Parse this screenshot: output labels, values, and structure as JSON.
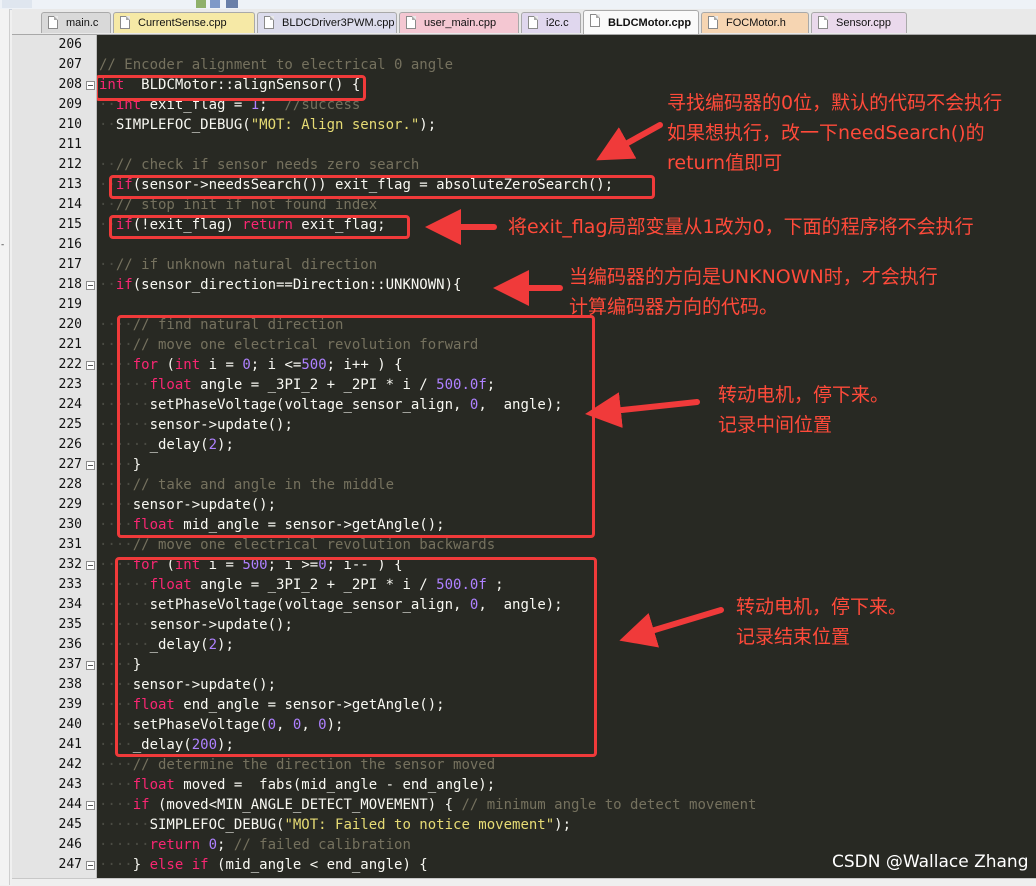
{
  "tabs": [
    {
      "label": "main.c",
      "color": "#d9d9d9",
      "active": false
    },
    {
      "label": "CurrentSense.cpp",
      "color": "#f6e9a6",
      "active": false
    },
    {
      "label": "BLDCDriver3PWM.cpp",
      "color": "#dcdcec",
      "active": false
    },
    {
      "label": "user_main.cpp",
      "color": "#f4c7d2",
      "active": false
    },
    {
      "label": "i2c.c",
      "color": "#e0d7ee",
      "active": false
    },
    {
      "label": "BLDCMotor.cpp",
      "color": "#fafafa",
      "active": true
    },
    {
      "label": "FOCMotor.h",
      "color": "#f6d5b2",
      "active": false
    },
    {
      "label": "Sensor.cpp",
      "color": "#ead9ec",
      "active": false
    }
  ],
  "line_numbers": [
    "206",
    "207",
    "208",
    "209",
    "210",
    "211",
    "212",
    "213",
    "214",
    "215",
    "216",
    "217",
    "218",
    "219",
    "220",
    "221",
    "222",
    "223",
    "224",
    "225",
    "226",
    "227",
    "228",
    "229",
    "230",
    "231",
    "232",
    "233",
    "234",
    "235",
    "236",
    "237",
    "238",
    "239",
    "240",
    "241",
    "242",
    "243",
    "244",
    "245",
    "246",
    "247"
  ],
  "fold_lines": [
    "208",
    "218",
    "222",
    "227",
    "232",
    "237",
    "244",
    "247"
  ],
  "code_lines": [
    [],
    [
      [
        "cm",
        "// Encoder alignment to electrical 0 angle"
      ]
    ],
    [
      [
        "ty",
        "int"
      ],
      [
        "",
        "  BLDCMotor::alignSensor() {"
      ]
    ],
    [
      [
        "ws",
        "  "
      ],
      [
        "ty",
        "int"
      ],
      [
        "",
        " exit_flag = "
      ],
      [
        "nm",
        "1"
      ],
      [
        "",
        ";  "
      ],
      [
        "cm",
        "//success"
      ]
    ],
    [
      [
        "ws",
        "  "
      ],
      [
        "",
        "SIMPLEFOC_DEBUG("
      ],
      [
        "st",
        "\"MOT: Align sensor.\""
      ],
      [
        "",
        ");"
      ]
    ],
    [],
    [
      [
        "ws",
        "  "
      ],
      [
        "cm",
        "// check if sensor needs zero search"
      ]
    ],
    [
      [
        "ws",
        "  "
      ],
      [
        "kw",
        "if"
      ],
      [
        "",
        "(sensor->needsSearch()) exit_flag = absoluteZeroSearch();"
      ]
    ],
    [
      [
        "ws",
        "  "
      ],
      [
        "cm",
        "// stop init if not found index"
      ]
    ],
    [
      [
        "ws",
        "  "
      ],
      [
        "kw",
        "if"
      ],
      [
        "",
        "(!exit_flag) "
      ],
      [
        "kw",
        "return"
      ],
      [
        "",
        " exit_flag;"
      ]
    ],
    [],
    [
      [
        "ws",
        "  "
      ],
      [
        "cm",
        "// if unknown natural direction"
      ]
    ],
    [
      [
        "ws",
        "  "
      ],
      [
        "kw",
        "if"
      ],
      [
        "",
        "(sensor_direction==Direction::UNKNOWN){"
      ]
    ],
    [],
    [
      [
        "ws",
        "    "
      ],
      [
        "cm",
        "// find natural direction"
      ]
    ],
    [
      [
        "ws",
        "    "
      ],
      [
        "cm",
        "// move one electrical revolution forward"
      ]
    ],
    [
      [
        "ws",
        "    "
      ],
      [
        "kw",
        "for"
      ],
      [
        "",
        " ("
      ],
      [
        "ty",
        "int"
      ],
      [
        "",
        " i = "
      ],
      [
        "nm",
        "0"
      ],
      [
        "",
        "; i <="
      ],
      [
        "nm",
        "500"
      ],
      [
        "",
        "; i++ ) {"
      ]
    ],
    [
      [
        "ws",
        "      "
      ],
      [
        "ty",
        "float"
      ],
      [
        "",
        " angle = _3PI_2 + _2PI * i / "
      ],
      [
        "nm",
        "500.0f"
      ],
      [
        "",
        ";"
      ]
    ],
    [
      [
        "ws",
        "      "
      ],
      [
        "",
        "setPhaseVoltage(voltage_sensor_align, "
      ],
      [
        "nm",
        "0"
      ],
      [
        "",
        ",  angle);"
      ]
    ],
    [
      [
        "ws",
        "      "
      ],
      [
        "",
        "sensor->update();"
      ]
    ],
    [
      [
        "ws",
        "      "
      ],
      [
        "",
        "_delay("
      ],
      [
        "nm",
        "2"
      ],
      [
        "",
        ");"
      ]
    ],
    [
      [
        "ws",
        "    "
      ],
      [
        "",
        "}"
      ]
    ],
    [
      [
        "ws",
        "    "
      ],
      [
        "cm",
        "// take and angle in the middle"
      ]
    ],
    [
      [
        "ws",
        "    "
      ],
      [
        "",
        "sensor->update();"
      ]
    ],
    [
      [
        "ws",
        "    "
      ],
      [
        "ty",
        "float"
      ],
      [
        "",
        " mid_angle = sensor->getAngle();"
      ]
    ],
    [
      [
        "ws",
        "    "
      ],
      [
        "cm",
        "// move one electrical revolution backwards"
      ]
    ],
    [
      [
        "ws",
        "    "
      ],
      [
        "kw",
        "for"
      ],
      [
        "",
        " ("
      ],
      [
        "ty",
        "int"
      ],
      [
        "",
        " i = "
      ],
      [
        "nm",
        "500"
      ],
      [
        "",
        "; i >="
      ],
      [
        "nm",
        "0"
      ],
      [
        "",
        "; i-- ) {"
      ]
    ],
    [
      [
        "ws",
        "      "
      ],
      [
        "ty",
        "float"
      ],
      [
        "",
        " angle = _3PI_2 + _2PI * i / "
      ],
      [
        "nm",
        "500.0f"
      ],
      [
        "",
        " ;"
      ]
    ],
    [
      [
        "ws",
        "      "
      ],
      [
        "",
        "setPhaseVoltage(voltage_sensor_align, "
      ],
      [
        "nm",
        "0"
      ],
      [
        "",
        ",  angle);"
      ]
    ],
    [
      [
        "ws",
        "      "
      ],
      [
        "",
        "sensor->update();"
      ]
    ],
    [
      [
        "ws",
        "      "
      ],
      [
        "",
        "_delay("
      ],
      [
        "nm",
        "2"
      ],
      [
        "",
        ");"
      ]
    ],
    [
      [
        "ws",
        "    "
      ],
      [
        "",
        "}"
      ]
    ],
    [
      [
        "ws",
        "    "
      ],
      [
        "",
        "sensor->update();"
      ]
    ],
    [
      [
        "ws",
        "    "
      ],
      [
        "ty",
        "float"
      ],
      [
        "",
        " end_angle = sensor->getAngle();"
      ]
    ],
    [
      [
        "ws",
        "    "
      ],
      [
        "",
        "setPhaseVoltage("
      ],
      [
        "nm",
        "0"
      ],
      [
        "",
        ", "
      ],
      [
        "nm",
        "0"
      ],
      [
        "",
        ", "
      ],
      [
        "nm",
        "0"
      ],
      [
        "",
        ");"
      ]
    ],
    [
      [
        "ws",
        "    "
      ],
      [
        "",
        "_delay("
      ],
      [
        "nm",
        "200"
      ],
      [
        "",
        ");"
      ]
    ],
    [
      [
        "ws",
        "    "
      ],
      [
        "cm",
        "// determine the direction the sensor moved"
      ]
    ],
    [
      [
        "ws",
        "    "
      ],
      [
        "ty",
        "float"
      ],
      [
        "",
        " moved =  fabs(mid_angle - end_angle);"
      ]
    ],
    [
      [
        "ws",
        "    "
      ],
      [
        "kw",
        "if"
      ],
      [
        "",
        " (moved<MIN_ANGLE_DETECT_MOVEMENT) { "
      ],
      [
        "cm",
        "// minimum angle to detect movement"
      ]
    ],
    [
      [
        "ws",
        "      "
      ],
      [
        "",
        "SIMPLEFOC_DEBUG("
      ],
      [
        "st",
        "\"MOT: Failed to notice movement\""
      ],
      [
        "",
        ");"
      ]
    ],
    [
      [
        "ws",
        "      "
      ],
      [
        "kw",
        "return"
      ],
      [
        "",
        " "
      ],
      [
        "nm",
        "0"
      ],
      [
        "",
        "; "
      ],
      [
        "cm",
        "// failed calibration"
      ]
    ],
    [
      [
        "ws",
        "    "
      ],
      [
        "",
        "} "
      ],
      [
        "kw",
        "else"
      ],
      [
        "",
        " "
      ],
      [
        "kw",
        "if"
      ],
      [
        "",
        " (mid_angle < end_angle) {"
      ]
    ]
  ],
  "annotations": {
    "note1_line1": "寻找编码器的0位，默认的代码不会执行",
    "note1_line2": "如果想执行，改一下needSearch()的",
    "note1_line3": "return值即可",
    "note2": "将exit_flag局部变量从1改为0，下面的程序将不会执行",
    "note3_line1": "当编码器的方向是UNKNOWN时，才会执行",
    "note3_line2": "计算编码器方向的代码。",
    "note4_line1": "转动电机，停下来。",
    "note4_line2": "记录中间位置",
    "note5_line1": "转动电机，停下来。",
    "note5_line2": "记录结束位置"
  },
  "watermark": "CSDN @Wallace Zhang",
  "colors": {
    "annotation": "#f03a3a",
    "editor_bg": "#282923",
    "comment": "#75715e",
    "keyword": "#f92672",
    "number": "#ae81ff",
    "string": "#e6db74"
  }
}
